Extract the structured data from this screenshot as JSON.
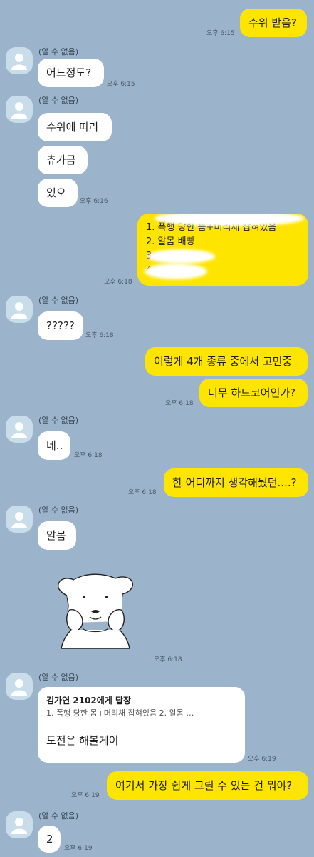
{
  "contact_name": "(알 수 없음)",
  "messages": {
    "m1": {
      "text": "수위 받음?",
      "time": "오후 6:15"
    },
    "m2": {
      "text": "어느정도?",
      "time": "오후 6:15"
    },
    "m3": {
      "text": "수위에 따라"
    },
    "m4": {
      "text": "츄가금"
    },
    "m5": {
      "text": "있오",
      "time": "오후 6:16"
    },
    "m6": {
      "lines": [
        "1. 폭행 당한 몸+머리채 잡혀있음",
        "2. 알몸 배빵",
        "3.",
        "4."
      ],
      "time": "오후 6:18"
    },
    "m7": {
      "text": "?????",
      "time": "오후 6:18"
    },
    "m8": {
      "text": "이렇게 4개 종류 중에서 고민중"
    },
    "m9": {
      "text": "너무 하드코어인가?",
      "time": "오후 6:18"
    },
    "m10": {
      "text": "네..",
      "time": "오후 6:18"
    },
    "m11": {
      "text": "한 어디까지 생각해뒀던....?",
      "time": "오후 6:18"
    },
    "m12": {
      "text": "알몸"
    },
    "m13": {
      "time": "오후 6:18",
      "sticker": "puppy-sticker"
    },
    "m14": {
      "reply_to": "김가연 2102에게 답장",
      "reply_preview": "1. 폭행 당한 몸+머리채 잡혀있음 2. 알몸 …",
      "text": "도전은 해볼게이",
      "time": "오후 6:19"
    },
    "m15": {
      "text": "여기서 가장 쉽게 그릴 수 있는 건 뭐야?",
      "time": "오후 6:19"
    },
    "m16": {
      "text": "2",
      "time": "오후 6:19"
    }
  },
  "colors": {
    "background": "#9bb4cb",
    "my_bubble": "#fee500",
    "their_bubble": "#ffffff",
    "avatar": "#c9dce9"
  }
}
